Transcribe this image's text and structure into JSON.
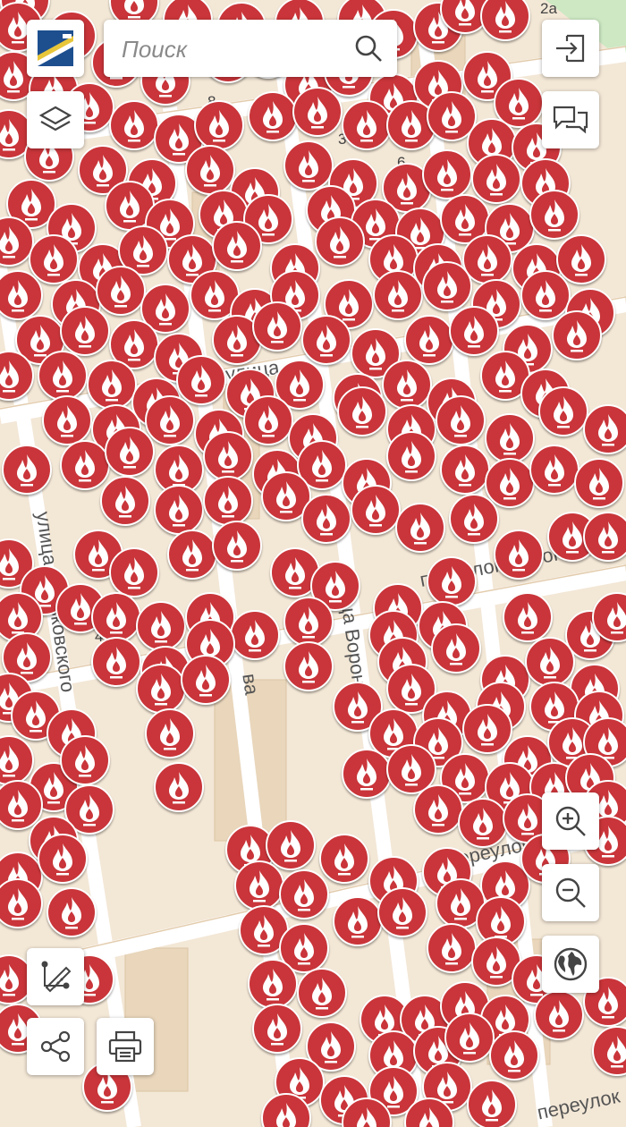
{
  "search": {
    "placeholder": "Поиск"
  },
  "map": {
    "street_labels": [
      "улица Даньковского",
      "улица",
      "переулок Воронеж",
      "улица Воронеж",
      "переулок",
      "переулок",
      "ва"
    ],
    "house_numbers": [
      "2а",
      "8",
      "3",
      "6",
      "4"
    ],
    "marker_icon": "gas-flame-icon",
    "colors": {
      "marker": "#c9353a",
      "background": "#f3e7d6",
      "road": "#ffffff",
      "building": "#e6d3b8",
      "park": "#cde8c3"
    }
  },
  "controls": {
    "logo": "city-logo",
    "layers": "layers-icon",
    "login": "login-icon",
    "feedback": "chat-bubbles-icon",
    "zoom_in": "zoom-in-icon",
    "zoom_out": "zoom-out-icon",
    "globe": "globe-icon",
    "measure": "ruler-icon",
    "share": "share-icon",
    "print": "printer-icon"
  }
}
